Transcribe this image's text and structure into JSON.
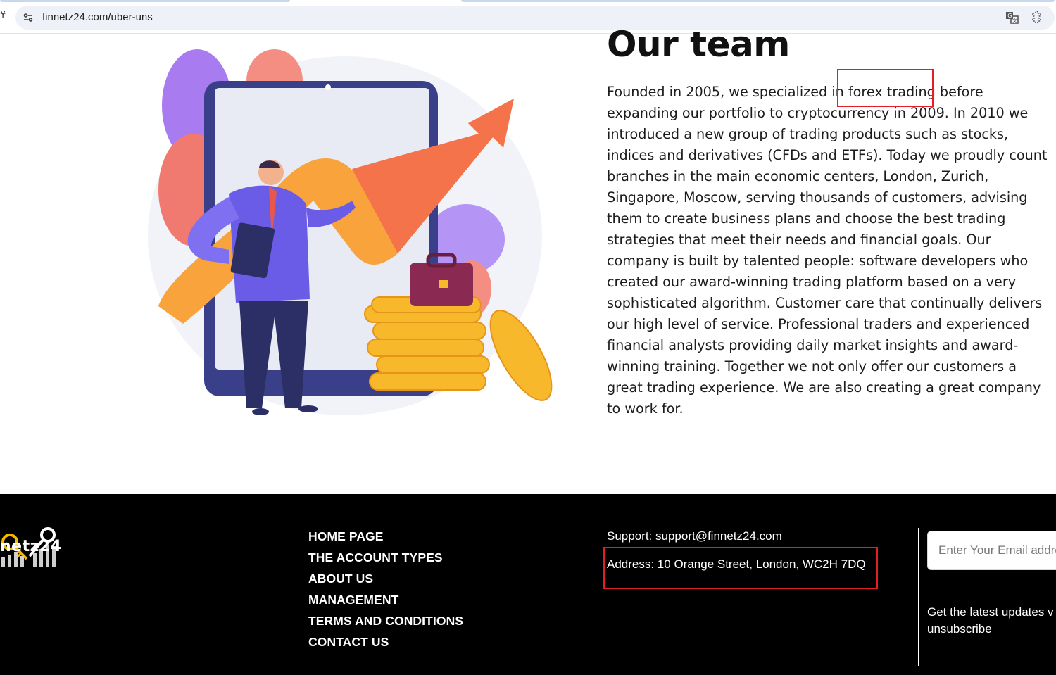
{
  "browser": {
    "url": "finnetz24.com/uber-uns",
    "nav_glyph": "¥"
  },
  "hero": {
    "title": "Our team",
    "description": "Founded in 2005, we specialized in forex trading before expanding our portfolio to cryptocurrency in 2009. In 2010 we introduced a new group of trading products such as stocks, indices and derivatives (CFDs and ETFs). Today we proudly count branches in the main economic centers, London, Zurich, Singapore, Moscow, serving thousands of customers, advising them to create business plans and choose the best trading strategies that meet their needs and financial goals. Our company is built by talented people: software developers who created our award-winning trading platform based on a very sophisticated algorithm. Customer care that continually delivers our high level of service. Professional traders and experienced financial analysts providing daily market insights and award-winning training. Together we not only offer our customers a great trading experience. We are also creating a great company to work for."
  },
  "footer": {
    "logo_text": "netz24",
    "nav": [
      "HOME PAGE",
      "THE ACCOUNT TYPES",
      "ABOUT US",
      "MANAGEMENT",
      "TERMS AND CONDITIONS",
      "CONTACT US"
    ],
    "support": "Support: support@finnetz24.com",
    "address": "Address: 10 Orange Street, London, WC2H 7DQ",
    "email_placeholder": "Enter Your Email address",
    "newsletter_line1": "Get the latest updates v",
    "newsletter_line2": "unsubscribe"
  },
  "colors": {
    "footer_bg": "#000000",
    "highlight": "#e31e24",
    "accent_orange": "#f58a3c",
    "accent_purple": "#7b6cf0",
    "logo_yellow": "#f5b800"
  },
  "icons": [
    "site-info-icon",
    "translate-icon",
    "extension-icon"
  ]
}
